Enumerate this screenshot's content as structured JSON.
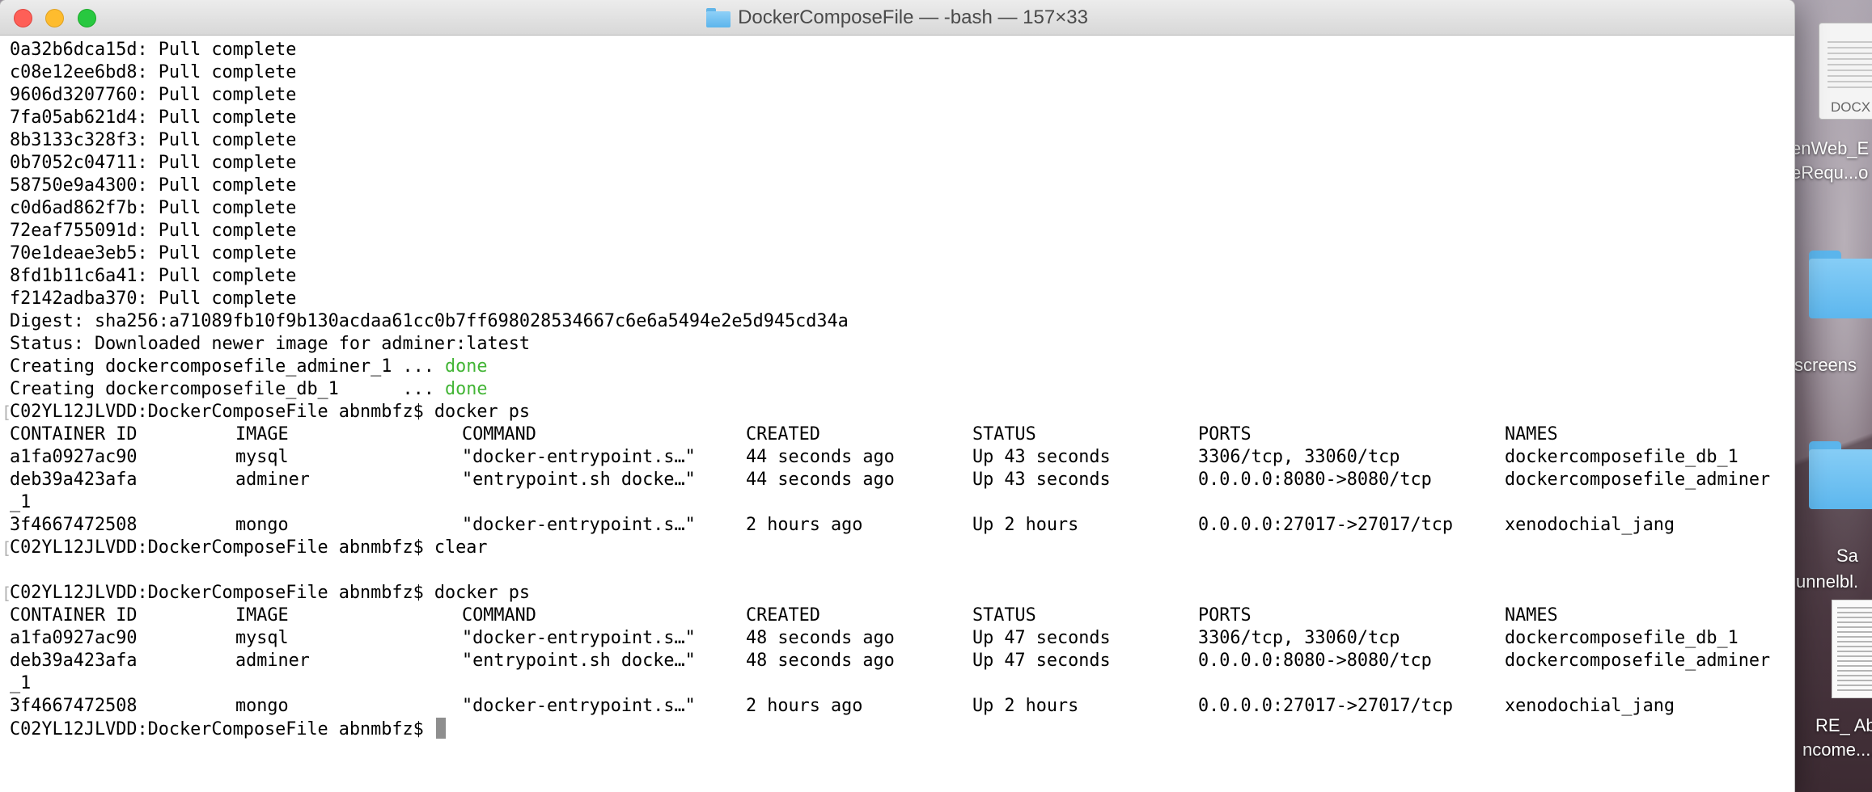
{
  "window": {
    "title": "DockerComposeFile — -bash — 157×33"
  },
  "terminal": {
    "pull_lines": [
      "0a32b6dca15d: Pull complete",
      "c08e12ee6bd8: Pull complete",
      "9606d3207760: Pull complete",
      "7fa05ab621d4: Pull complete",
      "8b3133c328f3: Pull complete",
      "0b7052c04711: Pull complete",
      "58750e9a4300: Pull complete",
      "c0d6ad862f7b: Pull complete",
      "72eaf755091d: Pull complete",
      "70e1deae3eb5: Pull complete",
      "8fd1b11c6a41: Pull complete",
      "f2142adba370: Pull complete"
    ],
    "digest": "Digest: sha256:a71089fb10f9b130acdaa61cc0b7ff698028534667c6e6a5494e2e5d945cd34a",
    "status": "Status: Downloaded newer image for adminer:latest",
    "creating": [
      {
        "text": "Creating dockercomposefile_adminer_1 ... ",
        "result": "done"
      },
      {
        "text": "Creating dockercomposefile_db_1      ... ",
        "result": "done"
      }
    ],
    "prompt_1": "C02YL12JLVDD:DockerComposeFile abnmbfz$ docker ps",
    "table_1": {
      "headers": [
        "CONTAINER ID",
        "IMAGE",
        "COMMAND",
        "CREATED",
        "STATUS",
        "PORTS",
        "NAMES"
      ],
      "rows": [
        [
          "a1fa0927ac90",
          "mysql",
          "\"docker-entrypoint.s…\"",
          "44 seconds ago",
          "Up 43 seconds",
          "3306/tcp, 33060/tcp",
          "dockercomposefile_db_1"
        ],
        [
          "deb39a423afa",
          "adminer",
          "\"entrypoint.sh docke…\"",
          "44 seconds ago",
          "Up 43 seconds",
          "0.0.0.0:8080->8080/tcp",
          "dockercomposefile_adminer"
        ],
        [
          "_1",
          "",
          "",
          "",
          "",
          "",
          ""
        ],
        [
          "3f4667472508",
          "mongo",
          "\"docker-entrypoint.s…\"",
          "2 hours ago",
          "Up 2 hours",
          "0.0.0.0:27017->27017/tcp",
          "xenodochial_jang"
        ]
      ]
    },
    "prompt_2": "C02YL12JLVDD:DockerComposeFile abnmbfz$ clear",
    "prompt_3": "C02YL12JLVDD:DockerComposeFile abnmbfz$ docker ps",
    "table_2": {
      "headers": [
        "CONTAINER ID",
        "IMAGE",
        "COMMAND",
        "CREATED",
        "STATUS",
        "PORTS",
        "NAMES"
      ],
      "rows": [
        [
          "a1fa0927ac90",
          "mysql",
          "\"docker-entrypoint.s…\"",
          "48 seconds ago",
          "Up 47 seconds",
          "3306/tcp, 33060/tcp",
          "dockercomposefile_db_1"
        ],
        [
          "deb39a423afa",
          "adminer",
          "\"entrypoint.sh docke…\"",
          "48 seconds ago",
          "Up 47 seconds",
          "0.0.0.0:8080->8080/tcp",
          "dockercomposefile_adminer"
        ],
        [
          "_1",
          "",
          "",
          "",
          "",
          "",
          ""
        ],
        [
          "3f4667472508",
          "mongo",
          "\"docker-entrypoint.s…\"",
          "2 hours ago",
          "Up 2 hours",
          "0.0.0.0:27017->27017/tcp",
          "xenodochial_jang"
        ]
      ]
    },
    "prompt_4": "C02YL12JLVDD:DockerComposeFile abnmbfz$ "
  },
  "desktop": {
    "docx_tag": "DOCX",
    "item1_line1": "enWeb_E",
    "item1_line2": "eRequ...o",
    "item2_label": "screens",
    "item3_line1": "Sa",
    "item3_line2": "unnelbl.",
    "item4_line1": "RE_ Ab",
    "item4_line2": "ncome...."
  },
  "colors": {
    "done": "#43b536",
    "cursor": "#8e8e8e"
  }
}
